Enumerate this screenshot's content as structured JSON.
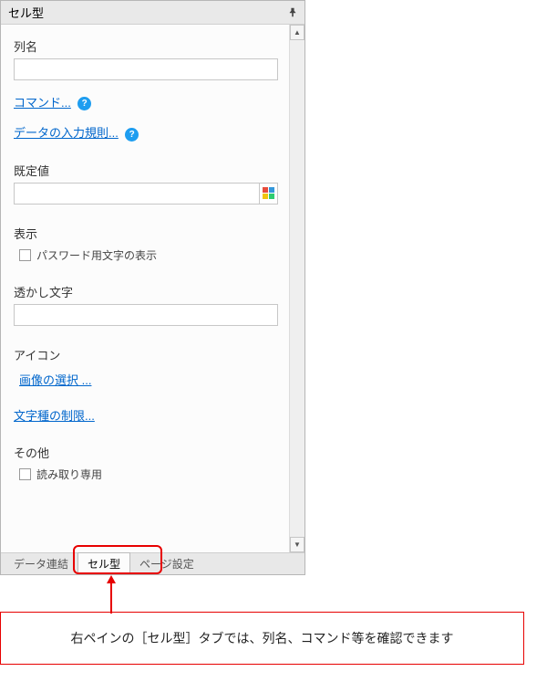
{
  "header": {
    "title": "セル型"
  },
  "sections": {
    "columnName": {
      "label": "列名",
      "value": ""
    },
    "command": {
      "label": "コマンド...",
      "help": "?"
    },
    "validation": {
      "label": "データの入力規則...",
      "help": "?"
    },
    "defaultVal": {
      "label": "既定値",
      "value": ""
    },
    "display": {
      "label": "表示",
      "passwordChk": "パスワード用文字の表示"
    },
    "watermark": {
      "label": "透かし文字",
      "value": ""
    },
    "icon": {
      "label": "アイコン",
      "selectImage": "画像の選択 ..."
    },
    "charLimit": {
      "label": "文字種の制限..."
    },
    "other": {
      "label": "その他",
      "readonlyChk": "読み取り専用"
    }
  },
  "tabs": {
    "dataLink": "データ連結",
    "cellType": "セル型",
    "pageSetup": "ページ設定"
  },
  "callout": {
    "text": "右ペインの［セル型］タブでは、列名、コマンド等を確認できます"
  }
}
